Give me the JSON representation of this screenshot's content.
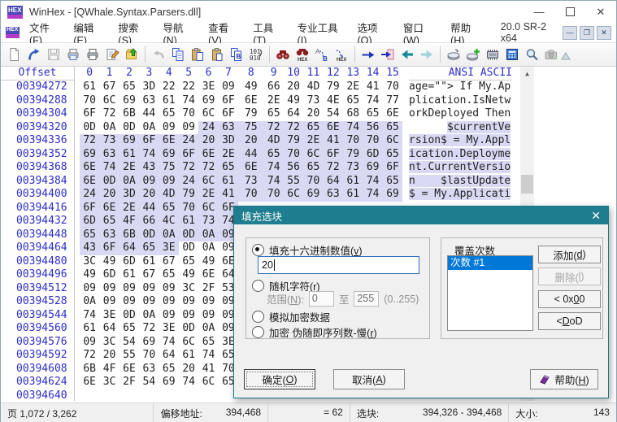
{
  "colors": {
    "accent_teal": "#1e7d8e",
    "selection": "#d9d9f3",
    "offset_blue": "#2e2ec8",
    "list_selection": "#0078d7",
    "dialog_bg": "#f0f0f0"
  },
  "window": {
    "title": "WinHex - [QWhale.Syntax.Parsers.dll]",
    "logo_text": "HEX",
    "version": "20.0 SR-2 x64",
    "controls": {
      "minimize": "—",
      "maximize": "",
      "close": "✕"
    },
    "mdi_controls": {
      "minimize": "—",
      "restore": "❐",
      "close": "✕"
    }
  },
  "menu": {
    "items": [
      "文件(F)",
      "编辑(E)",
      "搜索(S)",
      "导航(N)",
      "查看(V)",
      "工具(T)",
      "专业工具(I)",
      "选项(O)",
      "窗口(W)",
      "帮助(H)"
    ]
  },
  "toolbar": {
    "icons": [
      "new-file",
      "open-file",
      "save",
      "print-preview",
      "print",
      "properties",
      "folder-up",
      "undo",
      "copy",
      "paste-write",
      "paste",
      "copy-hex-values",
      "convert-binary",
      "find-text",
      "find-hex",
      "continue-search",
      "continue-search-hex",
      "goto-offset",
      "goto-page",
      "back",
      "forward",
      "open-disk",
      "clone-disk",
      "ram-editor",
      "calculator",
      "magnifier",
      "screenshot"
    ],
    "disabled": [
      "save",
      "undo",
      "forward",
      "screenshot"
    ]
  },
  "hex": {
    "header": {
      "offset_label": "Offset",
      "columns": [
        "0",
        "1",
        "2",
        "3",
        "4",
        "5",
        "6",
        "7",
        "8",
        "9",
        "10",
        "11",
        "12",
        "13",
        "14",
        "15"
      ],
      "ascii_label": "ANSI ASCII"
    },
    "rows": [
      {
        "offset": "00394272",
        "bytes": "61 67 65 3D 22 22 3E 09 49 66 20 4D 79 2E 41 70",
        "ascii": "age=\"\"> If My.Ap",
        "sel": null
      },
      {
        "offset": "00394288",
        "bytes": "70 6C 69 63 61 74 69 6F 6E 2E 49 73 4E 65 74 77",
        "ascii": "plication.IsNetw",
        "sel": null
      },
      {
        "offset": "00394304",
        "bytes": "6F 72 6B 44 65 70 6C 6F 79 65 64 20 54 68 65 6E",
        "ascii": "orkDeployed Then",
        "sel": null
      },
      {
        "offset": "00394320",
        "bytes": "0D 0A 0D 0A 09 09 24 63 75 72 72 65 6E 74 56 65",
        "ascii": "      $currentVe",
        "sel": [
          6,
          15
        ]
      },
      {
        "offset": "00394336",
        "bytes": "72 73 69 6F 6E 24 20 3D 20 4D 79 2E 41 70 70 6C",
        "ascii": "rsion$ = My.Appl",
        "sel": [
          0,
          15
        ]
      },
      {
        "offset": "00394352",
        "bytes": "69 63 61 74 69 6F 6E 2E 44 65 70 6C 6F 79 6D 65",
        "ascii": "ication.Deployme",
        "sel": [
          0,
          15
        ]
      },
      {
        "offset": "00394368",
        "bytes": "6E 74 2E 43 75 72 72 65 6E 74 56 65 72 73 69 6F",
        "ascii": "nt.CurrentVersio",
        "sel": [
          0,
          15
        ]
      },
      {
        "offset": "00394384",
        "bytes": "6E 0D 0A 09 09 24 6C 61 73 74 55 70 64 61 74 65",
        "ascii": "n    $lastUpdate",
        "sel": [
          0,
          15
        ]
      },
      {
        "offset": "00394400",
        "bytes": "24 20 3D 20 4D 79 2E 41 70 70 6C 69 63 61 74 69",
        "ascii": "$ = My.Applicati",
        "sel": [
          0,
          15
        ]
      },
      {
        "offset": "00394416",
        "bytes": "6F 6E 2E 44 65 70 6C 6F",
        "ascii": "",
        "sel": [
          0,
          15
        ]
      },
      {
        "offset": "00394432",
        "bytes": "6D 65 4F 66 4C 61 73 74",
        "ascii": "",
        "sel": [
          0,
          15
        ]
      },
      {
        "offset": "00394448",
        "bytes": "65 63 6B 0D 0A 0D 0A 09",
        "ascii": "",
        "sel": [
          0,
          15
        ]
      },
      {
        "offset": "00394464",
        "bytes": "43 6F 64 65 3E 0D 0A 09",
        "ascii": "",
        "sel": [
          0,
          4
        ]
      },
      {
        "offset": "00394480",
        "bytes": "3C 49 6D 61 67 65 49 6E",
        "ascii": "",
        "sel": null
      },
      {
        "offset": "00394496",
        "bytes": "49 6D 61 67 65 49 6E 64",
        "ascii": "",
        "sel": null
      },
      {
        "offset": "00394512",
        "bytes": "09 09 09 09 09 3C 2F 53",
        "ascii": "",
        "sel": null
      },
      {
        "offset": "00394528",
        "bytes": "0A 09 09 09 09 09 09 09",
        "ascii": "",
        "sel": null
      },
      {
        "offset": "00394544",
        "bytes": "74 3E 0D 0A 09 09 09 09",
        "ascii": "",
        "sel": null
      },
      {
        "offset": "00394560",
        "bytes": "61 64 65 72 3E 0D 0A 09",
        "ascii": "",
        "sel": null
      },
      {
        "offset": "00394576",
        "bytes": "09 3C 54 69 74 6C 65 3E",
        "ascii": "",
        "sel": null
      },
      {
        "offset": "00394592",
        "bytes": "72 20 55 70 64 61 74 65",
        "ascii": "",
        "sel": null
      },
      {
        "offset": "00394608",
        "bytes": "6B 4F 6E 63 65 20 41 70",
        "ascii": "",
        "sel": null
      },
      {
        "offset": "00394624",
        "bytes": "6E 3C 2F 54 69 74 6C 65",
        "ascii": "",
        "sel": null
      },
      {
        "offset": "00394640",
        "bytes": "",
        "ascii": "",
        "sel": null
      }
    ]
  },
  "dialog": {
    "title": "填充选块",
    "close_icon": "✕",
    "options": [
      {
        "label": "填充十六进制数值(v)",
        "selected": true
      },
      {
        "label": "随机字符(r)",
        "selected": false
      },
      {
        "label": "模拟加密数据",
        "selected": false
      },
      {
        "label": "加密 伪随即序列数-慢(r)",
        "selected": false
      }
    ],
    "hex_value": "20",
    "range": {
      "label": "范围(N):",
      "from": "0",
      "to_word": "至",
      "to": "255",
      "hint": "(0..255)"
    },
    "overwrite": {
      "label": "覆盖次数",
      "items": [
        {
          "label": "次数 #1",
          "selected": true
        }
      ]
    },
    "buttons": {
      "add": "添加(d)",
      "delete": "删除(l)",
      "zero": "< 0x00",
      "dod": "< DoD",
      "ok": "确定(O)",
      "cancel": "取消(A)",
      "help": "帮助(H)"
    }
  },
  "status": {
    "page": "页 1,072 / 3,262",
    "offset_label": "偏移地址:",
    "offset_value": "394,468",
    "decimal": "= 62",
    "block_label": "选块:",
    "block_value": "394,326 - 394,468",
    "size_label": "大小:",
    "size_value": "143"
  }
}
